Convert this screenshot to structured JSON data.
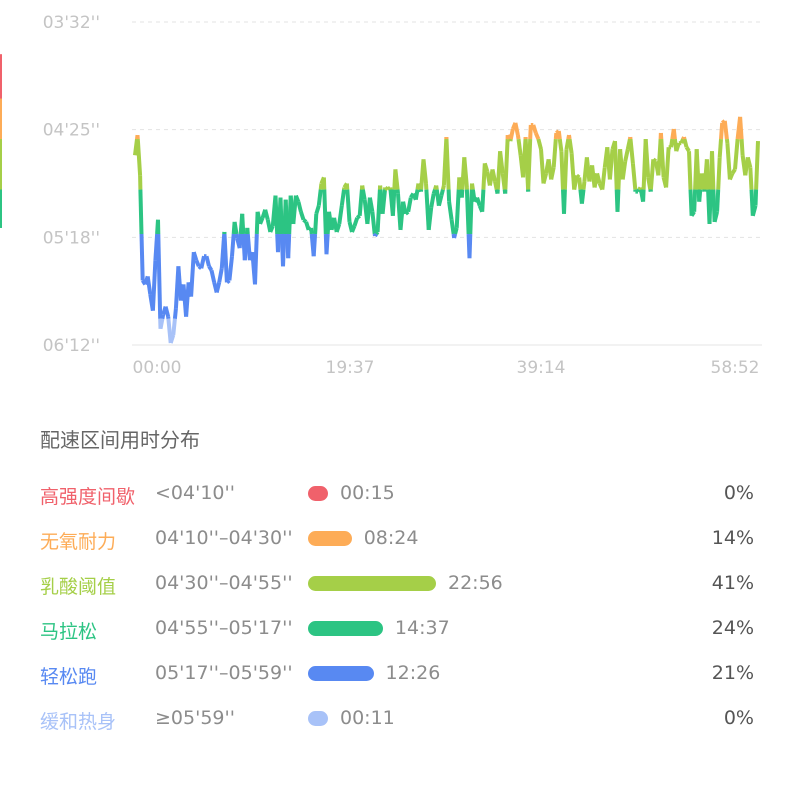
{
  "chart_data": {
    "type": "area",
    "y_axis": {
      "ticks": [
        "03'32''",
        "04'25''",
        "05'18''",
        "06'12''"
      ],
      "reversed": true,
      "unit": "pace min'sec'' per km"
    },
    "x_axis": {
      "ticks": [
        "00:00",
        "19:37",
        "39:14",
        "58:52"
      ],
      "range_minutes": [
        0,
        58.87
      ]
    },
    "grid": "dashed horizontal",
    "zone_boundaries_seconds": [
      250,
      270,
      295,
      317,
      359
    ],
    "series": [
      {
        "x_min": [
          0.0,
          0.24,
          0.48,
          0.73,
          0.97,
          1.21,
          1.45,
          1.7,
          1.94,
          2.18,
          2.42,
          2.67,
          2.91,
          3.15,
          3.39,
          3.64,
          3.88,
          4.12,
          4.36,
          4.61,
          4.85,
          5.09,
          5.33,
          5.58,
          5.82,
          6.06,
          6.3,
          6.55,
          6.79,
          7.03,
          7.27,
          7.52,
          7.76,
          8.0,
          8.24,
          8.49,
          8.73,
          8.97,
          9.21,
          9.46,
          9.7,
          9.94,
          10.18,
          10.43,
          10.67,
          10.91,
          11.15,
          11.4,
          11.64,
          11.88,
          12.12,
          12.37,
          12.61,
          12.85,
          13.09,
          13.34,
          13.58,
          13.82,
          14.06,
          14.31,
          14.55,
          14.79,
          15.03,
          15.28,
          15.52,
          15.76,
          16.0,
          16.25,
          16.49,
          16.73,
          16.97,
          17.22,
          17.46,
          17.7,
          17.94,
          18.19,
          18.43,
          18.67,
          18.91,
          19.16,
          19.4,
          19.64,
          19.88,
          20.13,
          20.37,
          20.61,
          20.85,
          21.1,
          21.34,
          21.58,
          21.82,
          22.07,
          22.31,
          22.55,
          22.79,
          23.04,
          23.28,
          23.52,
          23.76,
          24.01,
          24.25,
          24.49,
          24.73,
          24.98,
          25.22,
          25.46,
          25.7,
          25.95,
          26.19,
          26.43,
          26.67,
          26.92,
          27.16,
          27.4,
          27.64,
          27.89,
          28.13,
          28.37,
          28.61,
          28.86,
          29.1,
          29.34,
          29.58,
          29.83,
          30.07,
          30.31,
          30.55,
          30.8,
          31.04,
          31.28,
          31.52,
          31.77,
          32.01,
          32.25,
          32.49,
          32.74,
          32.98,
          33.22,
          33.46,
          33.71,
          33.95,
          34.19,
          34.43,
          34.68,
          34.92,
          35.16,
          35.4,
          35.65,
          35.89,
          36.13,
          36.37,
          36.62,
          36.86,
          37.1,
          37.34,
          37.59,
          37.83,
          38.07,
          38.31,
          38.56,
          38.8,
          39.04,
          39.28,
          39.53,
          39.77,
          40.01,
          40.25,
          40.5,
          40.74,
          40.98,
          41.22,
          41.47,
          41.71,
          41.95,
          42.19,
          42.44,
          42.68,
          42.92,
          43.16,
          43.41,
          43.65,
          43.89,
          44.13,
          44.38,
          44.62,
          44.86,
          45.1,
          45.35,
          45.59,
          45.83,
          46.07,
          46.32,
          46.56,
          46.8,
          47.04,
          47.29,
          47.53,
          47.77,
          48.01,
          48.26,
          48.5,
          48.74,
          48.98,
          49.23,
          49.47,
          49.71,
          49.95,
          50.2,
          50.44,
          50.68,
          50.92,
          51.17,
          51.41,
          51.65,
          51.89,
          52.14,
          52.38,
          52.62,
          52.86,
          53.11,
          53.35,
          53.59,
          53.83,
          54.08,
          54.32,
          54.56,
          54.8,
          55.05,
          55.29,
          55.53,
          55.77,
          56.02,
          56.26,
          56.5,
          56.74,
          56.99,
          57.23,
          57.47,
          57.71,
          57.96,
          58.2,
          58.44,
          58.68,
          58.93,
          59.17
        ],
        "pace_sec": [
          278,
          268,
          288,
          340,
          342,
          338,
          347,
          355,
          330,
          310,
          364,
          357,
          353,
          358,
          371,
          367,
          354,
          333,
          350,
          342,
          358,
          341,
          348,
          326,
          330,
          333,
          334,
          328,
          328,
          333,
          335,
          341,
          346,
          341,
          334,
          316,
          341,
          340,
          328,
          311,
          319,
          324,
          307,
          330,
          314,
          330,
          326,
          342,
          306,
          312,
          309,
          305,
          310,
          316,
          313,
          298,
          326,
          299,
          333,
          300,
          329,
          298,
          312,
          298,
          301,
          306,
          310,
          311,
          315,
          314,
          328,
          307,
          303,
          292,
          289,
          327,
          306,
          315,
          309,
          316,
          312,
          303,
          294,
          292,
          311,
          316,
          313,
          309,
          308,
          293,
          300,
          312,
          299,
          306,
          318,
          316,
          293,
          307,
          294,
          295,
          294,
          308,
          285,
          297,
          315,
          301,
          307,
          306,
          299,
          297,
          300,
          292,
          296,
          280,
          292,
          315,
          304,
          297,
          293,
          303,
          298,
          293,
          269,
          301,
          310,
          319,
          314,
          289,
          299,
          279,
          294,
          329,
          292,
          301,
          299,
          303,
          306,
          282,
          286,
          293,
          285,
          291,
          297,
          276,
          287,
          297,
          268,
          271,
          265,
          262,
          268,
          278,
          289,
          269,
          296,
          263,
          263,
          267,
          270,
          275,
          292,
          287,
          280,
          290,
          284,
          267,
          266,
          276,
          307,
          275,
          268,
          277,
          295,
          288,
          289,
          302,
          291,
          279,
          291,
          283,
          294,
          287,
          292,
          295,
          284,
          274,
          290,
          275,
          271,
          306,
          275,
          290,
          281,
          275,
          269,
          282,
          296,
          296,
          294,
          301,
          270,
          289,
          296,
          280,
          281,
          288,
          267,
          289,
          294,
          274,
          274,
          265,
          276,
          272,
          272,
          269,
          274,
          276,
          308,
          306,
          275,
          301,
          287,
          296,
          280,
          312,
          276,
          311,
          306,
          279,
          262,
          261,
          272,
          290,
          287,
          285,
          270,
          259,
          278,
          288,
          279,
          284,
          308,
          303,
          271,
          288,
          283,
          273,
          281,
          314,
          272,
          298,
          297,
          273,
          297,
          294,
          270,
          266,
          267,
          267,
          245,
          243,
          228,
          265,
          301,
          301
        ]
      }
    ]
  },
  "zones": {
    "title": "配速区间用时分布",
    "items": [
      {
        "name": "高强度间歇",
        "range": "<04'10''",
        "time": "00:15",
        "pct": "0%",
        "color": "#f0616b",
        "fraction": 0.0
      },
      {
        "name": "无氧耐力",
        "range": "04'10''–04'30''",
        "time": "08:24",
        "pct": "14%",
        "color": "#fdac57",
        "fraction": 0.14
      },
      {
        "name": "乳酸阈值",
        "range": "04'30''–04'55''",
        "time": "22:56",
        "pct": "41%",
        "color": "#a5cf48",
        "fraction": 0.41
      },
      {
        "name": "马拉松",
        "range": "04'55''–05'17''",
        "time": "14:37",
        "pct": "24%",
        "color": "#2cc483",
        "fraction": 0.24
      },
      {
        "name": "轻松跑",
        "range": "05'17''–05'59''",
        "time": "12:26",
        "pct": "21%",
        "color": "#5889f2",
        "fraction": 0.21
      },
      {
        "name": "缓和热身",
        "range": "≥05'59''",
        "time": "00:11",
        "pct": "0%",
        "color": "#a8c2f8",
        "fraction": 0.0
      }
    ]
  }
}
